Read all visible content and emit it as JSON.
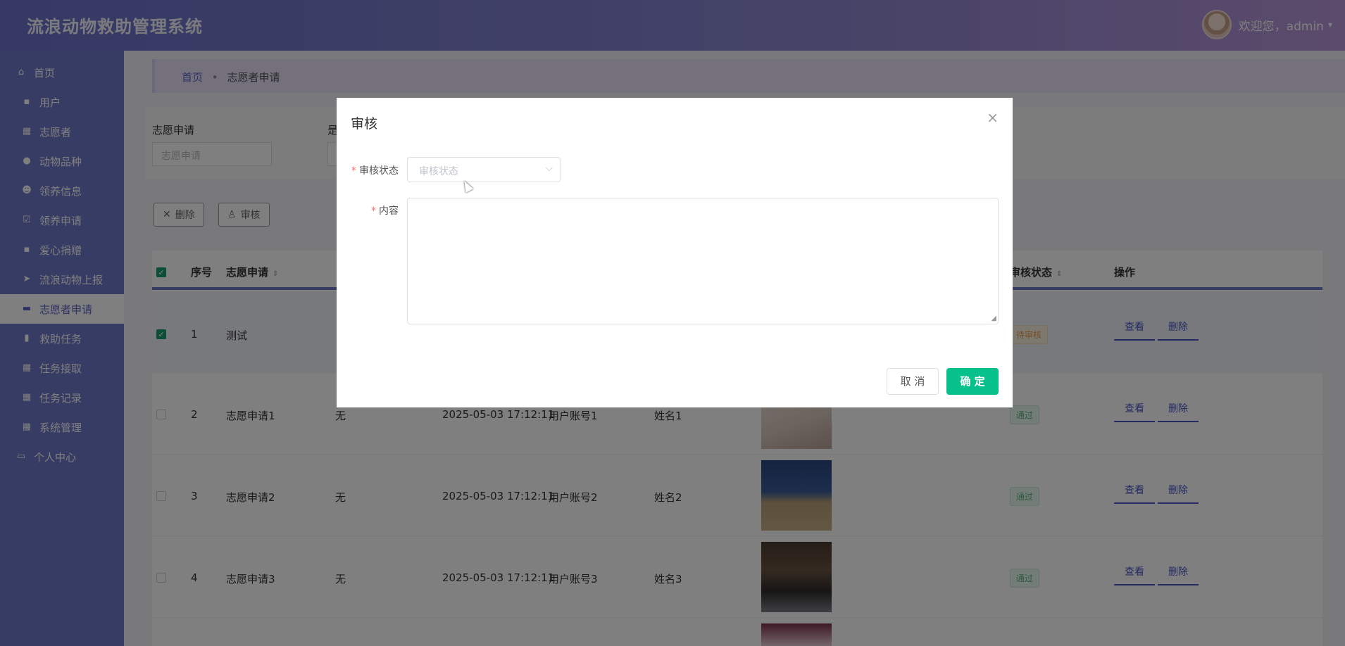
{
  "app": {
    "title": "流浪动物救助管理系统"
  },
  "user": {
    "greeting": "欢迎您，admin",
    "caret": "▾"
  },
  "sidebar": {
    "items": [
      {
        "label": "首页",
        "icon": "home-icon",
        "glyph": "⌂"
      },
      {
        "label": "用户",
        "icon": "clipboard-icon",
        "glyph": "▪"
      },
      {
        "label": "志愿者",
        "icon": "grid-icon",
        "glyph": "▦"
      },
      {
        "label": "动物品种",
        "icon": "bulb-icon",
        "glyph": "●"
      },
      {
        "label": "领养信息",
        "icon": "person-icon",
        "glyph": "☻"
      },
      {
        "label": "领养申请",
        "icon": "check-icon",
        "glyph": "☑"
      },
      {
        "label": "爱心捐赠",
        "icon": "clipboard-icon",
        "glyph": "▪"
      },
      {
        "label": "流浪动物上报",
        "icon": "send-icon",
        "glyph": "➤"
      },
      {
        "label": "志愿者申请",
        "icon": "flag-icon",
        "glyph": "▬"
      },
      {
        "label": "救助任务",
        "icon": "book-icon",
        "glyph": "▮"
      },
      {
        "label": "任务接取",
        "icon": "grid-icon",
        "glyph": "▦"
      },
      {
        "label": "任务记录",
        "icon": "grid-icon",
        "glyph": "▦"
      },
      {
        "label": "系统管理",
        "icon": "grid-icon",
        "glyph": "▦"
      },
      {
        "label": "个人中心",
        "icon": "card-icon",
        "glyph": "▭"
      }
    ]
  },
  "breadcrumb": {
    "home": "首页",
    "sep": "•",
    "current": "志愿者申请"
  },
  "search": {
    "label": "志愿申请",
    "placeholder": "志愿申请",
    "label2": "是"
  },
  "toolbar": {
    "delete_label": "删除",
    "delete_glyph": "✕",
    "audit_label": "审核",
    "audit_glyph": "♙"
  },
  "table": {
    "headers": {
      "index": "序号",
      "name": "志愿申请",
      "status": "审核状态",
      "ops": "操作",
      "sort": "⇕"
    },
    "rows": [
      {
        "index": "1",
        "name": "测试",
        "remark": "",
        "time": "",
        "account": "",
        "realname": "",
        "status": "待审核",
        "selected": true
      },
      {
        "index": "2",
        "name": "志愿申请1",
        "remark": "无",
        "time": "2025-05-03 17:12:11",
        "account": "用户账号1",
        "realname": "姓名1",
        "status": "通过"
      },
      {
        "index": "3",
        "name": "志愿申请2",
        "remark": "无",
        "time": "2025-05-03 17:12:11",
        "account": "用户账号2",
        "realname": "姓名2",
        "status": "通过"
      },
      {
        "index": "4",
        "name": "志愿申请3",
        "remark": "无",
        "time": "2025-05-03 17:12:11",
        "account": "用户账号3",
        "realname": "姓名3",
        "status": "通过"
      }
    ],
    "view_label": "查看",
    "delete_label": "删除"
  },
  "dialog": {
    "title": "审核",
    "close_glyph": "×",
    "status_label": "审核状态",
    "status_placeholder": "审核状态",
    "content_label": "内容",
    "required_mark": "*",
    "arrow_glyph": "⌵",
    "resize_glyph": "◢",
    "cancel_label": "取 消",
    "ok_label": "确 定"
  },
  "colors": {
    "accent": "#6e79c9",
    "ok": "#07c08c",
    "link": "#4a55c5"
  }
}
